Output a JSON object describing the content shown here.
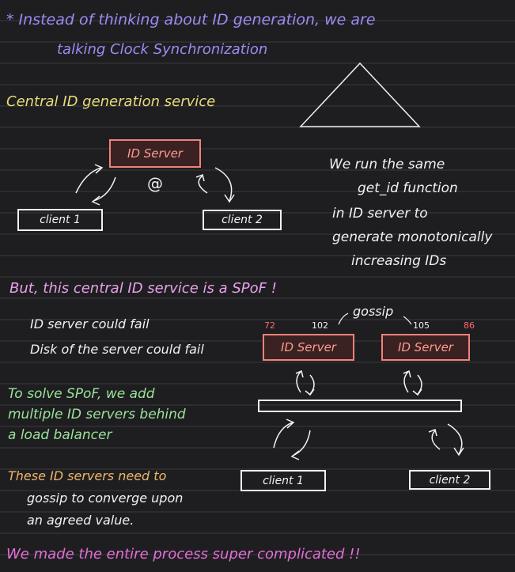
{
  "notes": {
    "line1": "* Instead of thinking about ID generation, we are",
    "line2": "talking Clock Synchronization",
    "central_heading": "Central ID generation service",
    "description": [
      "We run the same",
      "get_id function",
      "in ID server to",
      "generate monotonically",
      "increasing IDs"
    ],
    "spof_heading": "But, this central ID service is a SPoF !",
    "failure_1": "ID server could fail",
    "failure_2": "Disk of the server could fail",
    "solve": [
      "To solve SPoF, we add",
      "multiple ID servers behind",
      "a load balancer"
    ],
    "gossip_note": [
      "These ID servers need to",
      "gossip to converge upon",
      "an agreed value."
    ],
    "conclusion": "We made the entire process super complicated !!"
  },
  "diagram1": {
    "server": "ID Server",
    "client_1": "client 1",
    "client_2": "client 2",
    "center_symbol": "@"
  },
  "diagram2": {
    "server_1": "ID Server",
    "server_2": "ID Server",
    "gossip": "gossip",
    "num_72": "72",
    "num_102": "102",
    "num_105": "105",
    "num_86": "86",
    "client_1": "client 1",
    "client_2": "client 2"
  }
}
